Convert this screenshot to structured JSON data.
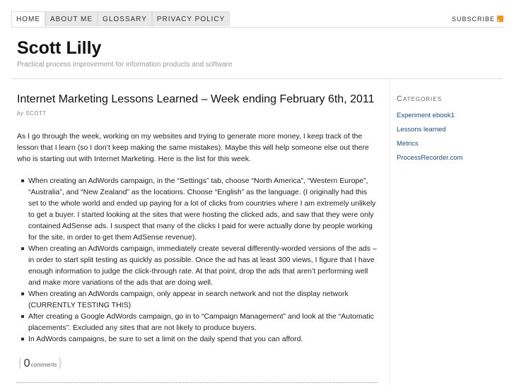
{
  "nav": {
    "tabs": [
      {
        "label": "HOME"
      },
      {
        "label": "ABOUT ME"
      },
      {
        "label": "GLOSSARY"
      },
      {
        "label": "PRIVACY POLICY"
      }
    ],
    "subscribe": "SUBSCRIBE",
    "rss_icon": "rss-icon",
    "rss_color": "#f7931e"
  },
  "site": {
    "title": "Scott Lilly",
    "tagline": "Practical process improvement for information products and software"
  },
  "post": {
    "title": "Internet Marketing Lessons Learned – Week ending February 6th, 2011",
    "by": "by",
    "author": "SCOTT",
    "intro": "As I go through the week, working on my websites and trying to generate more money, I keep track of the lesson that I learn (so I don’t keep making the same mistakes).  Maybe this will help someone else out there who is starting out with Internet Marketing.  Here is the list for this week.",
    "items": [
      "When creating an AdWords campaign, in the “Settings” tab, choose “North America”, “Western Europe”, “Australia”, and “New Zealand” as the locations.  Choose “English” as the language.  (I originally had this set to the whole world and ended up paying for a lot of clicks from countries where I am extremely unlikely to get a buyer.  I started looking at the sites that were hosting the clicked ads, and saw that they were only contained AdSense ads.  I suspect that many of the clicks I paid for were actually done by people working for the site, in order to get them AdSense revenue).",
      "When creating an AdWords campaign, immediately create several differently-worded versions of the ads – in order to start split testing as quickly as possible.  Once the ad has at least 300 views, I figure that I have enough information to judge the click-through rate.  At that point, drop the ads that aren’t performing well and make more variations of the ads that are doing well.",
      "When creating an AdWords campaign, only appear in search network and not the display network (CURRENTLY TESTING THIS)",
      "After creating a Google AdWords campaign, go in to “Campaign Management” and look at the “Automatic placements”.  Excluded any sites that are not likely to produce buyers.",
      "In AdWords campaigns, be sure to set a limit on the daily spend that you can afford."
    ],
    "comments_count": "0",
    "comments_label": "comments"
  },
  "sidebar": {
    "heading": "Categories",
    "items": [
      {
        "label": "Experiment ebook1"
      },
      {
        "label": "Lessons learned"
      },
      {
        "label": "Metrics"
      },
      {
        "label": "ProcessRecorder.com"
      }
    ]
  }
}
